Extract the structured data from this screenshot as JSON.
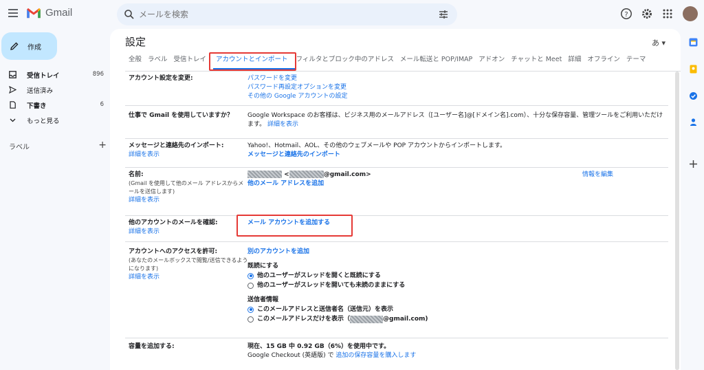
{
  "header": {
    "app_name": "Gmail",
    "search_placeholder": "メールを検索"
  },
  "sidebar": {
    "compose_label": "作成",
    "items": [
      {
        "label": "受信トレイ",
        "count": "896"
      },
      {
        "label": "送信済み",
        "count": ""
      },
      {
        "label": "下書き",
        "count": "6"
      },
      {
        "label": "もっと見る",
        "count": ""
      }
    ],
    "labels_title": "ラベル",
    "labels_add": "+"
  },
  "main": {
    "title": "設定",
    "lang_button": "あ ▾",
    "tabs": [
      "全般",
      "ラベル",
      "受信トレイ",
      "アカウントとインポート",
      "フィルタとブロック中のアドレス",
      "メール転送と POP/IMAP",
      "アドオン",
      "チャットと Meet",
      "詳細",
      "オフライン",
      "テーマ"
    ],
    "active_tab": "アカウントとインポート"
  },
  "settings": {
    "change_account": {
      "label": "アカウント設定を変更:",
      "links": [
        "パスワードを変更",
        "パスワード再設定オプションを変更",
        "その他の Google アカウントの設定"
      ]
    },
    "work": {
      "label": "仕事で Gmail を使用していますか？",
      "text": "Google Workspace のお客様は、ビジネス用のメールアドレス（[ユーザー名]@[ドメイン名].com）、十分な保存容量、管理ツールをご利用いただけます。",
      "link": "詳細を表示"
    },
    "import": {
      "label": "メッセージと連絡先のインポート:",
      "learn_more": "詳細を表示",
      "text": "Yahoo!、Hotmail、AOL、その他のウェブメールや POP アカウントからインポートします。",
      "action": "メッセージと連絡先のインポート"
    },
    "name": {
      "label": "名前:",
      "sub": "(Gmail を使用して他のメール アドレスからメールを送信します)",
      "learn_more": "詳細を表示",
      "email_prefix": " <",
      "email_suffix": "@gmail.com>",
      "add_address": "他のメール アドレスを追加",
      "edit": "情報を編集"
    },
    "check_mail": {
      "label": "他のアカウントのメールを確認:",
      "learn_more": "詳細を表示",
      "action": "メール アカウントを追加する"
    },
    "grant_access": {
      "label": "アカウントへのアクセスを許可:",
      "sub": "(あなたのメールボックスで閲覧/送信できるようになります)",
      "learn_more": "詳細を表示",
      "action": "別のアカウントを追加",
      "read_title": "既読にする",
      "read_opt1": "他のユーザーがスレッドを開くと既読にする",
      "read_opt2": "他のユーザーがスレッドを開いても未読のままにする",
      "sender_title": "送信者情報",
      "sender_opt1": "このメールアドレスと送信者名（送信元）を表示",
      "sender_opt2_prefix": "このメールアドレスだけを表示（",
      "sender_opt2_suffix": "@gmail.com)"
    },
    "storage": {
      "label": "容量を追加する:",
      "usage": "現在、15 GB 中 0.92 GB（6%）を使用中です。",
      "checkout": "Google Checkout (英語版) で ",
      "buy": "追加の保存容量を購入します"
    }
  },
  "colors": {
    "accent": "#1a73e8",
    "highlight": "#e53935",
    "compose_bg": "#c2e7ff"
  }
}
